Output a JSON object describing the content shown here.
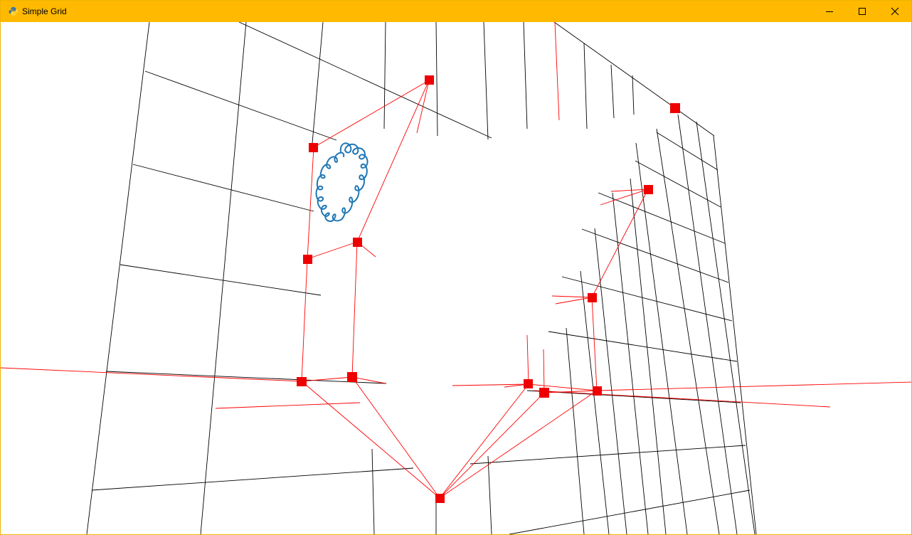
{
  "window": {
    "title": "Simple Grid",
    "icon": "python-icon",
    "titlebar_color": "#ffb900",
    "controls": {
      "minimize_icon": "minimize-icon",
      "maximize_icon": "maximize-icon",
      "close_icon": "close-icon"
    }
  },
  "scene": {
    "grid_line_color": "#000000",
    "path_color": "#ff0000",
    "node_color": "#ee0000",
    "spiral_color": "#1f77b4"
  }
}
